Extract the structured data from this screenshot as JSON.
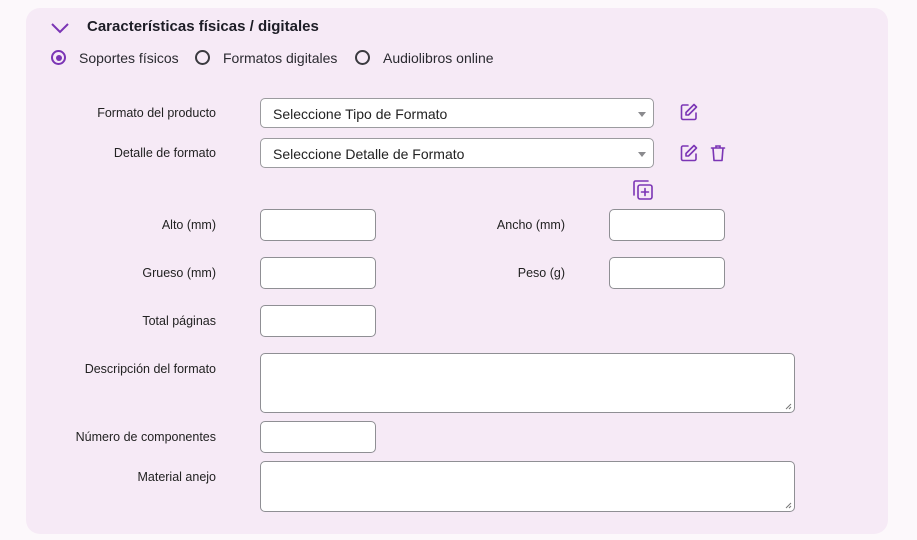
{
  "section": {
    "title": "Características físicas / digitales",
    "collapse_icon": "chevron-down-icon"
  },
  "support_types": {
    "selected": "Soportes físicos",
    "options": [
      "Soportes físicos",
      "Formatos digitales",
      "Audiolibros online"
    ]
  },
  "form": {
    "format_label": "Formato del producto",
    "format_value": "Seleccione Tipo de Formato",
    "detail_label": "Detalle de formato",
    "detail_value": "Seleccione Detalle de Formato",
    "height_label": "Alto (mm)",
    "height_value": "",
    "width_label": "Ancho (mm)",
    "width_value": "",
    "thickness_label": "Grueso (mm)",
    "thickness_value": "",
    "weight_label": "Peso (g)",
    "weight_value": "",
    "pages_label": "Total páginas",
    "pages_value": "",
    "description_label": "Descripción del formato",
    "description_value": "",
    "components_label": "Número de componentes",
    "components_value": "",
    "material_label": "Material anejo",
    "material_value": ""
  },
  "icons": {
    "edit": "edit-icon",
    "delete": "trash-icon",
    "add": "add-copy-icon"
  },
  "colors": {
    "accent": "#7b35b5",
    "panel": "#f6eaf6",
    "background": "#fcf8fb"
  }
}
